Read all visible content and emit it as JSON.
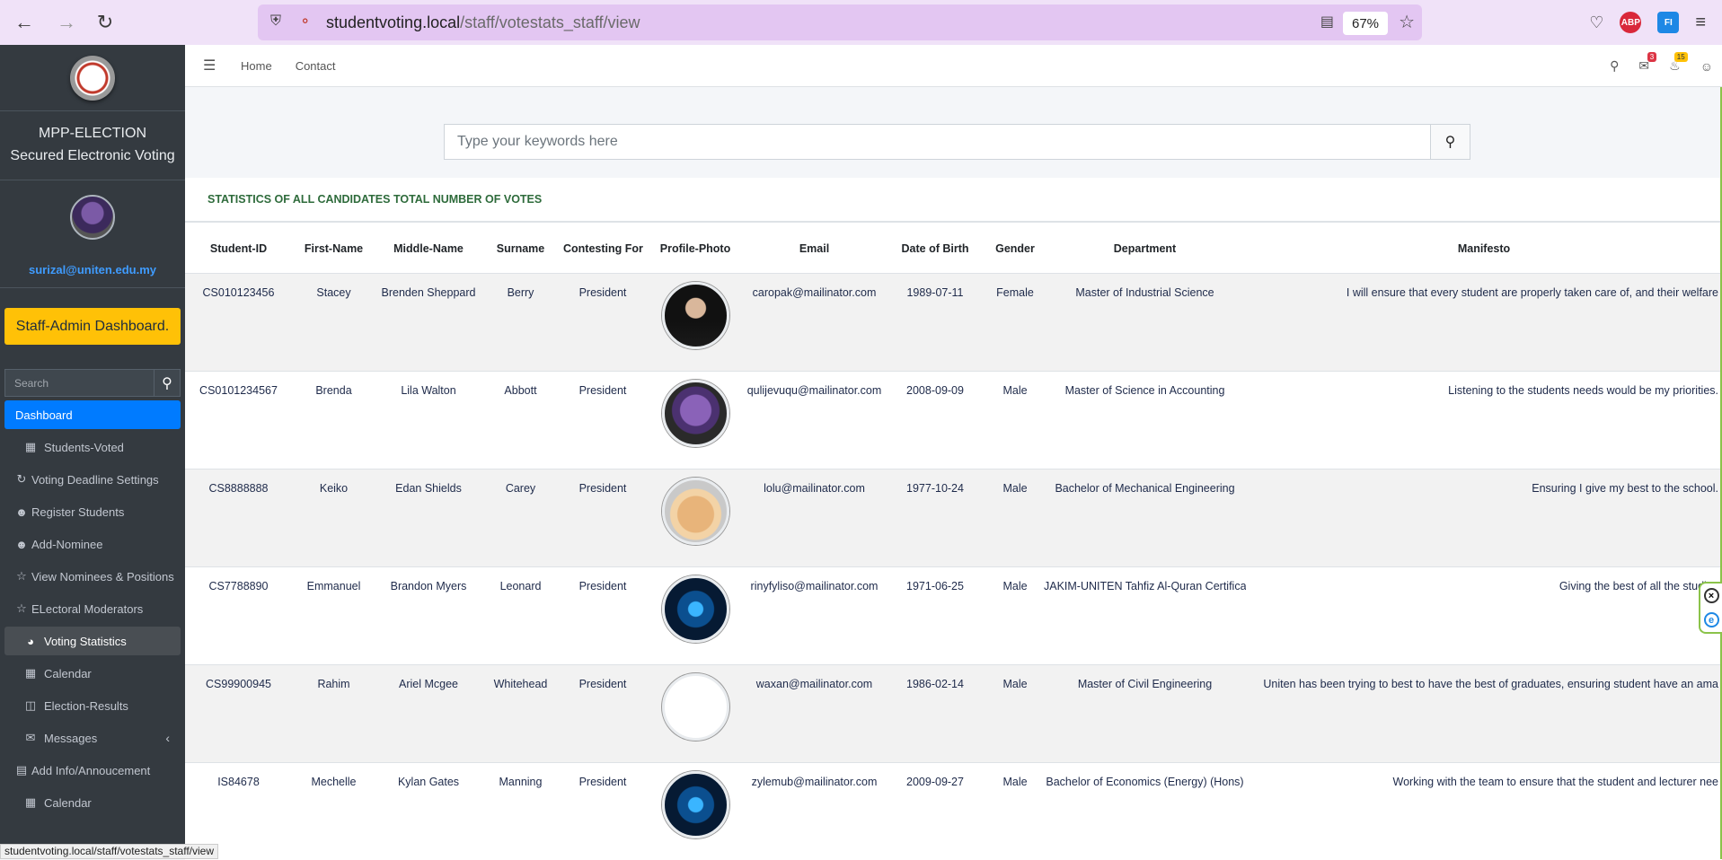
{
  "browser": {
    "url_host": "studentvoting.local",
    "url_path": "/staff/votestats_staff/view",
    "zoom": "67%",
    "status_url": "studentvoting.local/staff/votestats_staff/view",
    "extensions": [
      "pocket-icon",
      "adblock-icon",
      "fi-extension-icon"
    ],
    "adblock_label": "ABP",
    "fi_label": "FI"
  },
  "sidebar": {
    "brand_line1": "MPP-ELECTION",
    "brand_line2": "Secured Electronic Voting",
    "user_email": "surizal@uniten.edu.my",
    "staff_button": "Staff-Admin Dashboard.",
    "search_placeholder": "Search",
    "items": [
      {
        "label": "Dashboard",
        "icon": "dashboard"
      },
      {
        "label": "Students-Voted",
        "icon": "grid-icon"
      },
      {
        "label": "Voting Deadline Settings",
        "icon": "refresh-icon"
      },
      {
        "label": "Register Students",
        "icon": "user-plus-icon"
      },
      {
        "label": "Add-Nominee",
        "icon": "user-plus-icon"
      },
      {
        "label": "View Nominees & Positions",
        "icon": "star-icon"
      },
      {
        "label": "ELectoral Moderators",
        "icon": "star-icon"
      },
      {
        "label": "Voting Statistics",
        "icon": "pie-chart-icon"
      },
      {
        "label": "Calendar",
        "icon": "calendar-icon"
      },
      {
        "label": "Election-Results",
        "icon": "columns-icon"
      },
      {
        "label": "Messages",
        "icon": "envelope-icon"
      },
      {
        "label": "Add Info/Annoucement",
        "icon": "rss-icon"
      },
      {
        "label": "Calendar",
        "icon": "calendar-icon"
      }
    ]
  },
  "topnav": {
    "home": "Home",
    "contact": "Contact",
    "messages_badge": "3",
    "notifications_badge": "15"
  },
  "search": {
    "placeholder": "Type your keywords here"
  },
  "table": {
    "title": "STATISTICS OF ALL CANDIDATES TOTAL NUMBER OF VOTES",
    "headers": [
      "Student-ID",
      "First-Name",
      "Middle-Name",
      "Surname",
      "Contesting For",
      "Profile-Photo",
      "Email",
      "Date of Birth",
      "Gender",
      "Department",
      "Manifesto"
    ],
    "rows": [
      {
        "id": "CS010123456",
        "first": "Stacey",
        "middle": "Brenden Sheppard",
        "surname": "Berry",
        "contesting": "President",
        "photo": "ph-jobs",
        "email": "caropak@mailinator.com",
        "dob": "1989-07-11",
        "gender": "Female",
        "department": "Master of Industrial Science",
        "manifesto": "I will ensure that every student are properly taken care of, and their welfare"
      },
      {
        "id": "CS0101234567",
        "first": "Brenda",
        "middle": "Lila Walton",
        "surname": "Abbott",
        "contesting": "President",
        "photo": "ph-thanos",
        "email": "qulijevuqu@mailinator.com",
        "dob": "2008-09-09",
        "gender": "Male",
        "department": "Master of Science in Accounting",
        "manifesto": "Listening to the students needs would be my priorities."
      },
      {
        "id": "CS8888888",
        "first": "Keiko",
        "middle": "Edan Shields",
        "surname": "Carey",
        "contesting": "President",
        "photo": "ph-cat",
        "email": "lolu@mailinator.com",
        "dob": "1977-10-24",
        "gender": "Male",
        "department": "Bachelor of Mechanical Engineering",
        "manifesto": "Ensuring I give my best to the school."
      },
      {
        "id": "CS7788890",
        "first": "Emmanuel",
        "middle": "Brandon Myers",
        "surname": "Leonard",
        "contesting": "President",
        "photo": "ph-ai",
        "email": "rinyfyliso@mailinator.com",
        "dob": "1971-06-25",
        "gender": "Male",
        "department": "JAKIM-UNITEN Tahfiz Al-Quran Certification",
        "manifesto": "Giving the best of all the studies"
      },
      {
        "id": "CS99900945",
        "first": "Rahim",
        "middle": "Ariel Mcgee",
        "surname": "Whitehead",
        "contesting": "President",
        "photo": "ph-broken",
        "email": "waxan@mailinator.com",
        "dob": "1986-02-14",
        "gender": "Male",
        "department": "Master of Civil Engineering",
        "manifesto": "Uniten has been trying to best to have the best of graduates, ensuring student have an ama"
      },
      {
        "id": "IS84678",
        "first": "Mechelle",
        "middle": "Kylan Gates",
        "surname": "Manning",
        "contesting": "President",
        "photo": "ph-ai",
        "email": "zylemub@mailinator.com",
        "dob": "2009-09-27",
        "gender": "Male",
        "department": "Bachelor of Economics (Energy) (Hons)",
        "manifesto": "Working with the team to ensure that the student and lecturer nee"
      }
    ]
  }
}
